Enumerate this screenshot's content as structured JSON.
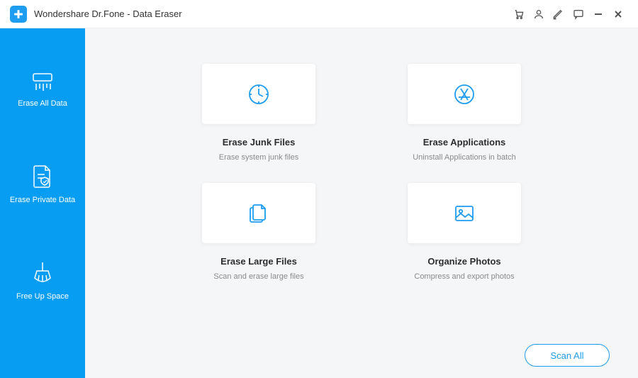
{
  "app": {
    "title": "Wondershare Dr.Fone - Data Eraser"
  },
  "sidebar": {
    "items": [
      {
        "label": "Erase All Data"
      },
      {
        "label": "Erase Private Data"
      },
      {
        "label": "Free Up Space"
      }
    ]
  },
  "cards": [
    {
      "title": "Erase Junk Files",
      "sub": "Erase system junk files"
    },
    {
      "title": "Erase Applications",
      "sub": "Uninstall Applications in batch"
    },
    {
      "title": "Erase Large Files",
      "sub": "Scan and erase large files"
    },
    {
      "title": "Organize Photos",
      "sub": "Compress and export photos"
    }
  ],
  "actions": {
    "scan_all": "Scan All"
  },
  "colors": {
    "accent": "#079df2",
    "icon_blue": "#1e9cf0"
  }
}
